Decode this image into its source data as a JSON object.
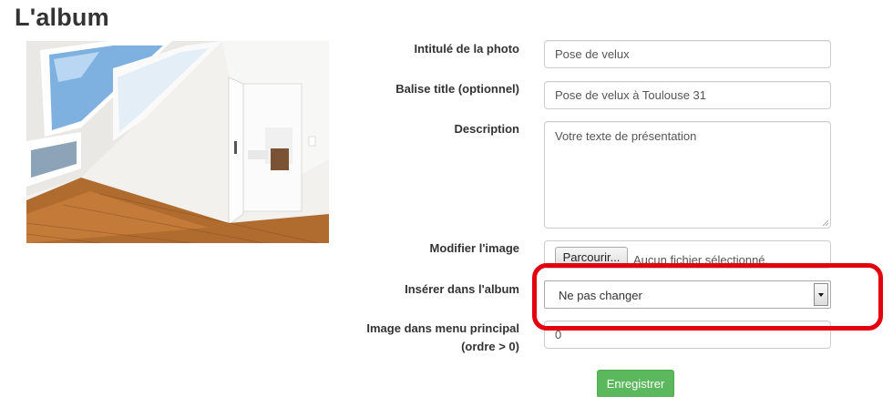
{
  "page": {
    "title": "L'album"
  },
  "photo": {
    "description": "attic-room-with-skylights"
  },
  "form": {
    "title_field": {
      "label": "Intitulé de la photo",
      "value": "Pose de velux"
    },
    "alt_field": {
      "label": "Balise title (optionnel)",
      "value": "Pose de velux à Toulouse 31"
    },
    "description_field": {
      "label": "Description",
      "value": "Votre texte de présentation"
    },
    "image_field": {
      "label": "Modifier l'image",
      "button_label": "Parcourir...",
      "status": "Aucun fichier sélectionné."
    },
    "album_field": {
      "label": "Insérer dans l'album",
      "selected": "Ne pas changer"
    },
    "menu_field": {
      "label_line1": "Image dans menu principal",
      "label_line2": "(ordre > 0)",
      "value": "0"
    },
    "submit_label": "Enregistrer"
  },
  "colors": {
    "highlight": "#e3000f",
    "submit": "#5cb85c"
  }
}
